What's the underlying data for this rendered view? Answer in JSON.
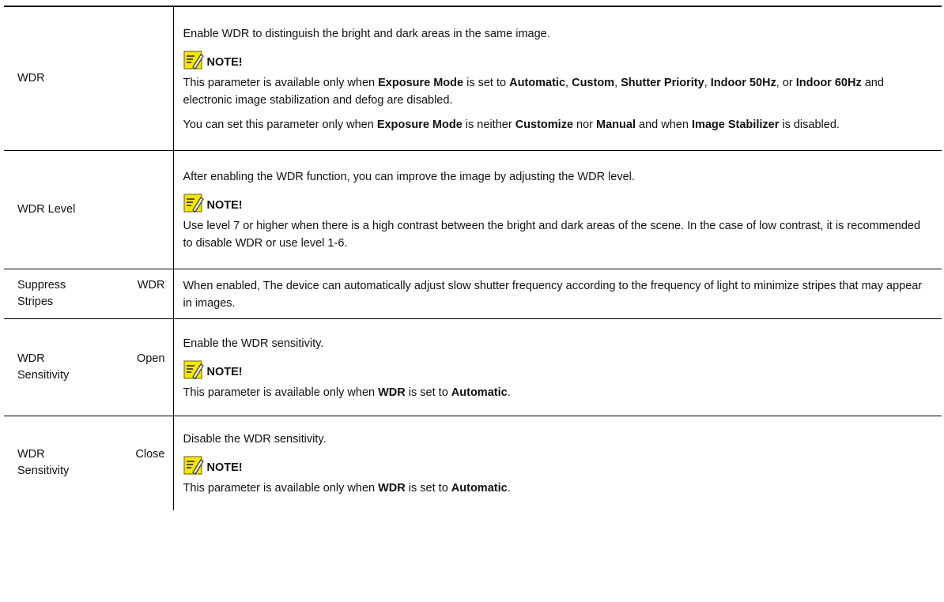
{
  "note_label": "NOTE!",
  "rows": [
    {
      "name": "WDR",
      "intro": "Enable WDR to distinguish the bright and dark areas in the same image.",
      "note1": {
        "s1": "This parameter is available only when ",
        "b1": "Exposure Mode",
        "s2": " is set to ",
        "b2": "Automatic",
        "s3": ", ",
        "b3": "Custom",
        "s4": ", ",
        "b4": "Shutter Priority",
        "s5": ", ",
        "b5": "Indoor 50Hz",
        "s6": ", or ",
        "b6": "Indoor 60Hz",
        "s7": " and electronic image stabilization and defog are disabled."
      },
      "note2": {
        "s1": "You can set this parameter only when ",
        "b1": "Exposure Mode",
        "s2": " is neither ",
        "b2": "Customize",
        "s3": " nor ",
        "b3": "Manual",
        "s4": " and when ",
        "b4": "Image Stabilizer",
        "s5": " is disabled."
      }
    },
    {
      "name": "WDR Level",
      "intro": "After enabling the WDR function, you can improve the image by adjusting the WDR level.",
      "note": "Use level 7 or higher when there is a high contrast between the bright and dark areas of the scene. In the case of low contrast, it is recommended to disable WDR or use level 1-6."
    },
    {
      "name_a": "Suppress",
      "name_b": "WDR",
      "name_c": "Stripes",
      "desc": "When enabled, The device can automatically adjust slow shutter frequency according to the frequency of light to minimize stripes that may appear in images."
    },
    {
      "name_a": "WDR",
      "name_b": "Open",
      "name_c": "Sensitivity",
      "intro": "Enable the WDR sensitivity.",
      "note": {
        "s1": "This parameter is available only when ",
        "b1": "WDR",
        "s2": " is set to ",
        "b2": "Automatic",
        "s3": "."
      }
    },
    {
      "name_a": "WDR",
      "name_b": "Close",
      "name_c": "Sensitivity",
      "intro": "Disable the WDR sensitivity.",
      "note": {
        "s1": "This parameter is available only when ",
        "b1": "WDR",
        "s2": " is set to ",
        "b2": "Automatic",
        "s3": "."
      }
    }
  ],
  "colors": {
    "note_icon_bg": "#f5e400",
    "note_icon_frame": "#7a7a2a",
    "border": "#000000"
  },
  "icons": {
    "note": "note-pencil-icon"
  }
}
